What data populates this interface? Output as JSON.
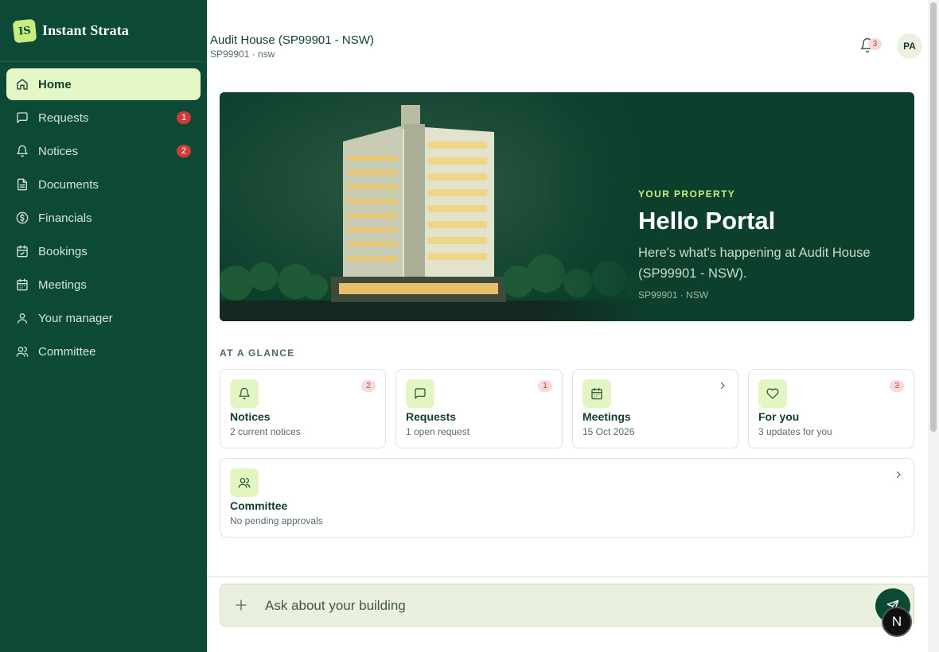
{
  "brand": {
    "logo_text": "IS",
    "name": "Instant Strata"
  },
  "sidebar": {
    "items": [
      {
        "label": "Home",
        "icon": "home-icon",
        "badge": ""
      },
      {
        "label": "Requests",
        "icon": "message-square-icon",
        "badge": "1"
      },
      {
        "label": "Notices",
        "icon": "bell-icon",
        "badge": "2"
      },
      {
        "label": "Documents",
        "icon": "file-icon",
        "badge": ""
      },
      {
        "label": "Financials",
        "icon": "dollar-circle-icon",
        "badge": ""
      },
      {
        "label": "Bookings",
        "icon": "calendar-check-icon",
        "badge": ""
      },
      {
        "label": "Meetings",
        "icon": "calendar-icon",
        "badge": ""
      },
      {
        "label": "Your manager",
        "icon": "user-icon",
        "badge": ""
      },
      {
        "label": "Committee",
        "icon": "users-icon",
        "badge": ""
      }
    ],
    "active": "Home"
  },
  "header": {
    "title": "Audit House (SP99901 - NSW)",
    "subtitle": "SP99901 · nsw",
    "notification_count": "3",
    "avatar_initials": "PA"
  },
  "hero": {
    "eyebrow": "YOUR PROPERTY",
    "title": "Hello Portal",
    "text": "Here's what's happening at Audit House (SP99901 - NSW).",
    "meta": "SP99901 · NSW"
  },
  "glance": {
    "label": "AT A GLANCE",
    "cards": [
      {
        "title": "Notices",
        "sub": "2 current notices",
        "badge": "2",
        "icon": "bell-icon"
      },
      {
        "title": "Requests",
        "sub": "1 open request",
        "badge": "1",
        "icon": "message-square-icon"
      },
      {
        "title": "Meetings",
        "sub": "15 Oct 2026",
        "badge": "",
        "icon": "calendar-icon"
      },
      {
        "title": "For you",
        "sub": "3 updates for you",
        "badge": "3",
        "icon": "heart-icon"
      },
      {
        "title": "Committee",
        "sub": "No pending approvals",
        "badge": "",
        "icon": "users-icon"
      }
    ]
  },
  "chat": {
    "placeholder": "Ask about your building"
  },
  "overlay": {
    "n_badge": "N"
  },
  "colors": {
    "sidebar": "#0c4a35",
    "accent": "#c8ec7e",
    "hero": "#0d3f2d",
    "badge": "#cf3b3b"
  }
}
